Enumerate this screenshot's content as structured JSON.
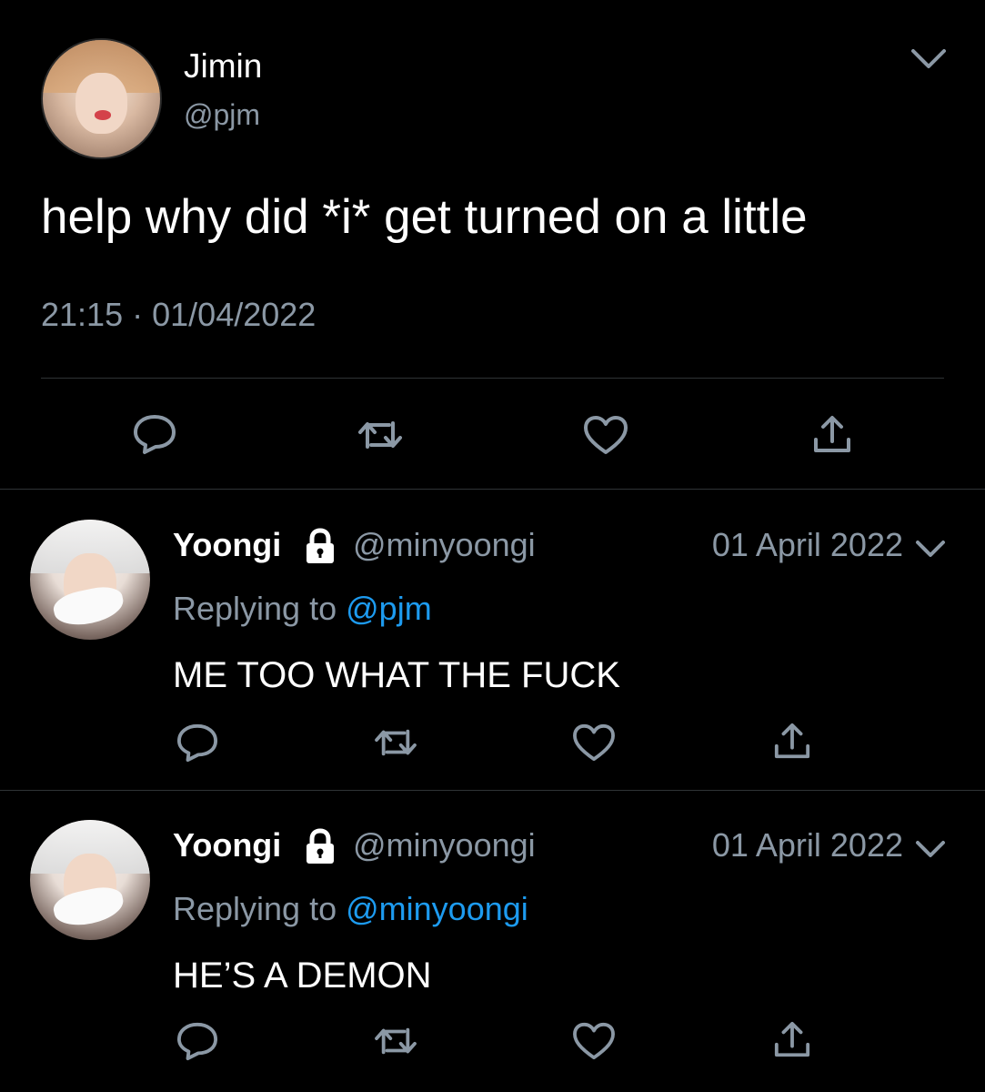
{
  "main_tweet": {
    "author_name": "Jimin",
    "author_handle": "@pjm",
    "text": "help why did *i* get turned on a little",
    "time": "21:15",
    "separator": "·",
    "date": "01/04/2022",
    "actions": [
      "reply-icon",
      "retweet-icon",
      "like-icon",
      "share-icon"
    ]
  },
  "replies": [
    {
      "author_name": "Yoongi",
      "author_handle": "@minyoongi",
      "date": "01 April 2022",
      "replying_prefix": "Replying to",
      "replying_to": "@pjm",
      "text": "ME TOO WHAT THE FUCK"
    },
    {
      "author_name": "Yoongi",
      "author_handle": "@minyoongi",
      "date": "01 April 2022",
      "replying_prefix": "Replying to",
      "replying_to": "@minyoongi",
      "text": "HE’S A DEMON"
    }
  ],
  "colors": {
    "background": "#000000",
    "primary_text": "#ffffff",
    "secondary_text": "#8b98a5",
    "mention": "#1d9bf0",
    "divider": "#2f3336"
  }
}
